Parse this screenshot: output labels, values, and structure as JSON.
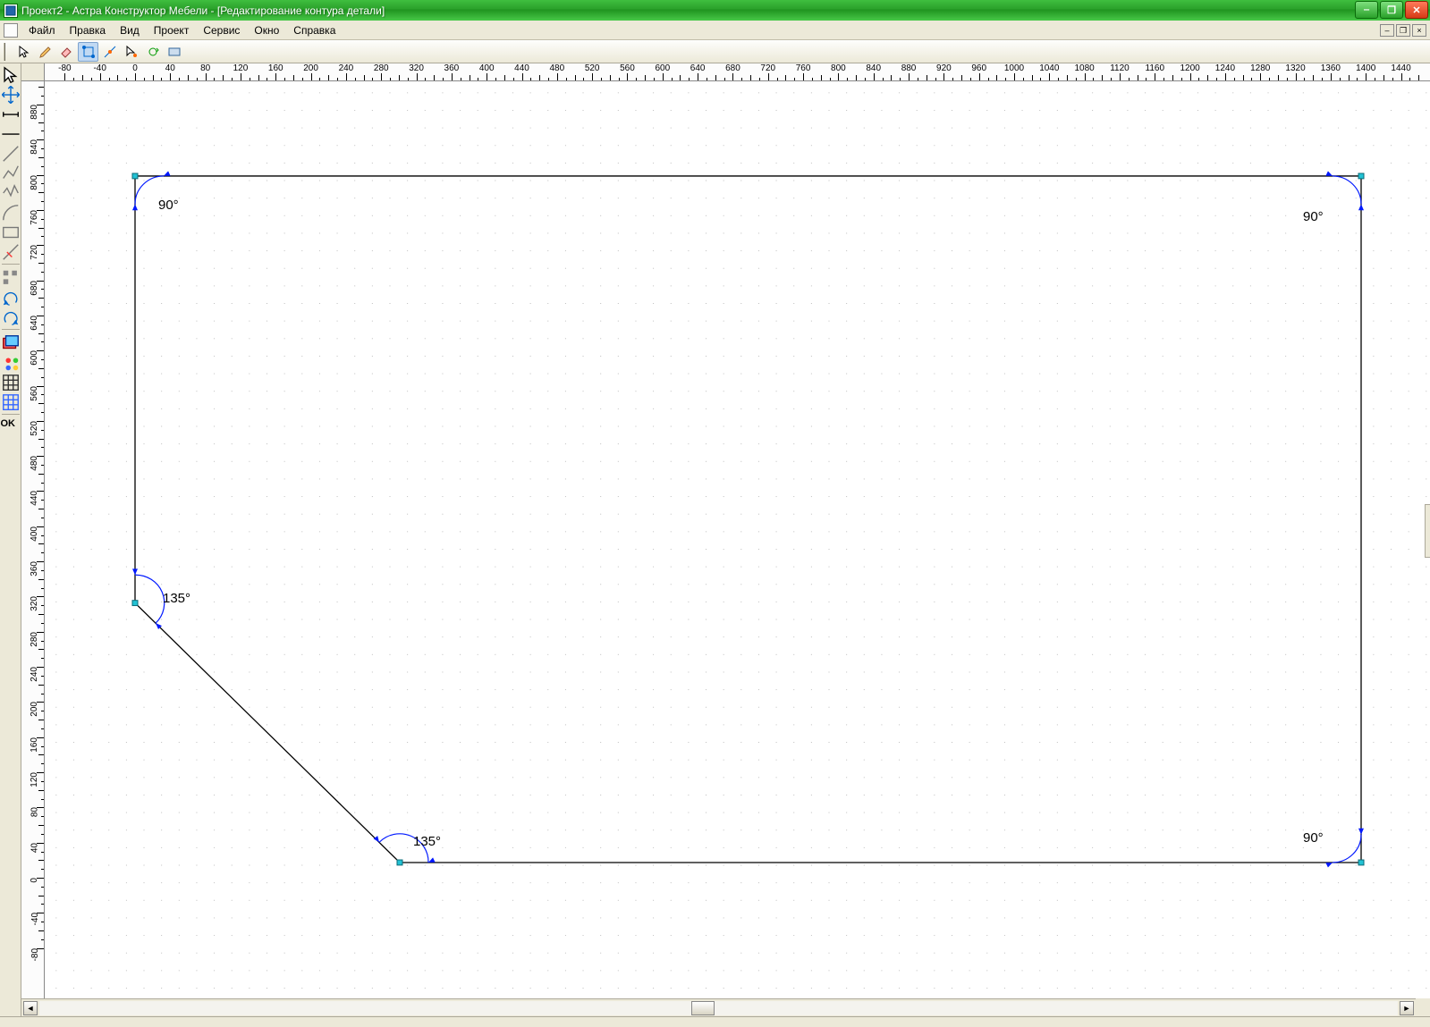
{
  "title": "Проект2 - Астра Конструктор Мебели - [Редактирование контура детали]",
  "menu": {
    "file": "Файл",
    "edit": "Правка",
    "view": "Вид",
    "project": "Проект",
    "service": "Сервис",
    "window": "Окно",
    "help": "Справка"
  },
  "toolbar": {
    "select": "tool-select",
    "pen": "tool-pen",
    "eraser": "tool-eraser",
    "snap_node": "tool-snap-node",
    "snap_mid": "tool-snap-mid",
    "snap_cur": "tool-snap-cursor",
    "cycle": "tool-cycle",
    "rect": "tool-rect"
  },
  "lefttools": {
    "cursor": "cursor",
    "move": "move",
    "dim": "dimension",
    "point": "point",
    "line": "line",
    "polyline": "polyline",
    "polyline2": "polyline-multi",
    "arc": "arc",
    "rect": "rectangle",
    "erase": "erase",
    "align": "align",
    "undo": "undo",
    "redo": "redo",
    "layers": "layers",
    "props": "properties",
    "grid": "grid-settings",
    "grid2": "grid-snap",
    "ok_label": "OK"
  },
  "angles": {
    "tl": "90°",
    "tr": "90°",
    "ml": "135°",
    "bl": "135°",
    "br": "90°"
  },
  "ruler": {
    "h_start": -80,
    "h_end": 1460,
    "v_start": -80,
    "v_end": 940
  },
  "colors": {
    "node": "#22aabb",
    "arc": "#0018ff",
    "line": "#000"
  }
}
